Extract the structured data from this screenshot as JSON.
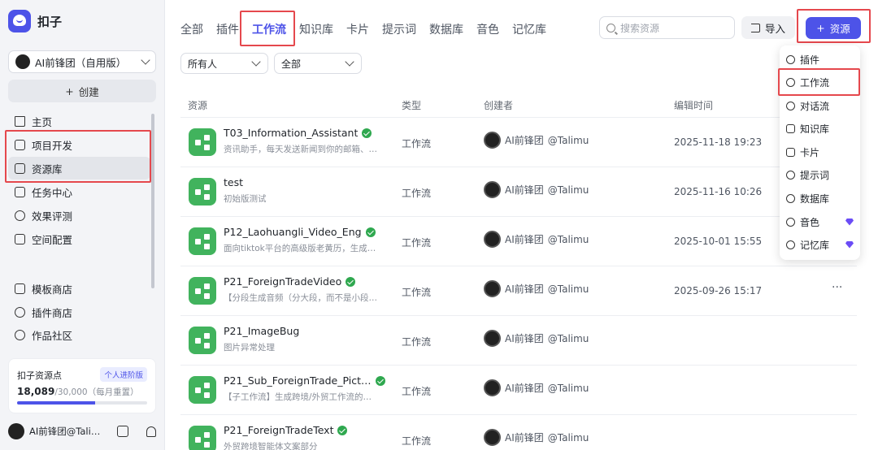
{
  "app": {
    "name": "扣子"
  },
  "sidebar": {
    "workspace": "AI前锋团（自用版）",
    "create_label": "创建",
    "nav": [
      {
        "label": "主页",
        "icon": "home-icon"
      },
      {
        "label": "项目开发",
        "icon": "project-icon"
      },
      {
        "label": "资源库",
        "icon": "library-icon"
      },
      {
        "label": "任务中心",
        "icon": "task-icon"
      },
      {
        "label": "效果评测",
        "icon": "evaluation-icon"
      },
      {
        "label": "空间配置",
        "icon": "space-config-icon"
      },
      {
        "label": "模板商店",
        "icon": "template-store-icon"
      },
      {
        "label": "插件商店",
        "icon": "plugin-store-icon"
      },
      {
        "label": "作品社区",
        "icon": "community-icon"
      }
    ],
    "points": {
      "title": "扣子资源点",
      "badge": "个人进阶版",
      "value": "18,089",
      "total": "/30,000",
      "reset": "（每月重置）",
      "progress": 0.603
    },
    "user": {
      "name": "AI前锋团@Tali…"
    }
  },
  "tabs": [
    "全部",
    "插件",
    "工作流",
    "知识库",
    "卡片",
    "提示词",
    "数据库",
    "音色",
    "记忆库"
  ],
  "active_tab": "工作流",
  "search": {
    "placeholder": "搜索资源"
  },
  "toolbar": {
    "import_label": "导入",
    "add_label": "资源"
  },
  "filters": {
    "owner": "所有人",
    "status": "全部"
  },
  "table": {
    "headers": {
      "resource": "资源",
      "type": "类型",
      "creator": "创建者",
      "edited": "编辑时间"
    },
    "rows": [
      {
        "name": "T03_Information_Assistant",
        "desc": "资讯助手，每天发送新闻到你的邮箱、…",
        "type": "工作流",
        "creator": "AI前锋团",
        "handle": "@Talimu",
        "time": "2025-11-18 19:23",
        "published": true
      },
      {
        "name": "test",
        "desc": "初始版测试",
        "type": "工作流",
        "creator": "AI前锋团",
        "handle": "@Talimu",
        "time": "2025-11-16 10:26",
        "published": false
      },
      {
        "name": "P12_Laohuangli_Video_Eng",
        "desc": "面向tiktok平台的高级版老黄历，生成…",
        "type": "工作流",
        "creator": "AI前锋团",
        "handle": "@Talimu",
        "time": "2025-10-01 15:55",
        "published": true
      },
      {
        "name": "P21_ForeignTradeVideo",
        "desc": "【分段生成音频（分大段，而不是小段…",
        "type": "工作流",
        "creator": "AI前锋团",
        "handle": "@Talimu",
        "time": "2025-09-26 15:17",
        "published": true,
        "more": "···"
      },
      {
        "name": "P21_ImageBug",
        "desc": "图片异常处理",
        "type": "工作流",
        "creator": "AI前锋团",
        "handle": "@Talimu",
        "time": "",
        "published": false
      },
      {
        "name": "P21_Sub_ForeignTrade_Pict…",
        "desc": "【子工作流】生成跨境/外贸工作流的…",
        "type": "工作流",
        "creator": "AI前锋团",
        "handle": "@Talimu",
        "time": "",
        "published": true
      },
      {
        "name": "P21_ForeignTradeText",
        "desc": "外贸跨境智能体文案部分",
        "type": "工作流",
        "creator": "AI前锋团",
        "handle": "@Talimu",
        "time": "",
        "published": true
      }
    ]
  },
  "dropdown": {
    "items": [
      {
        "label": "插件",
        "icon": "plugin-icon",
        "premium": false
      },
      {
        "label": "工作流",
        "icon": "workflow-icon",
        "premium": false
      },
      {
        "label": "对话流",
        "icon": "chatflow-icon",
        "premium": false
      },
      {
        "label": "知识库",
        "icon": "knowledge-icon",
        "premium": false
      },
      {
        "label": "卡片",
        "icon": "card-icon",
        "premium": false
      },
      {
        "label": "提示词",
        "icon": "prompt-icon",
        "premium": false
      },
      {
        "label": "数据库",
        "icon": "database-icon",
        "premium": false
      },
      {
        "label": "音色",
        "icon": "voice-icon",
        "premium": true
      },
      {
        "label": "记忆库",
        "icon": "memory-icon",
        "premium": true
      }
    ]
  },
  "colors": {
    "accent": "#4d53e8",
    "highlight": "#e5484d",
    "workflow_icon": "#41b35d",
    "verified": "#2fa84f"
  }
}
